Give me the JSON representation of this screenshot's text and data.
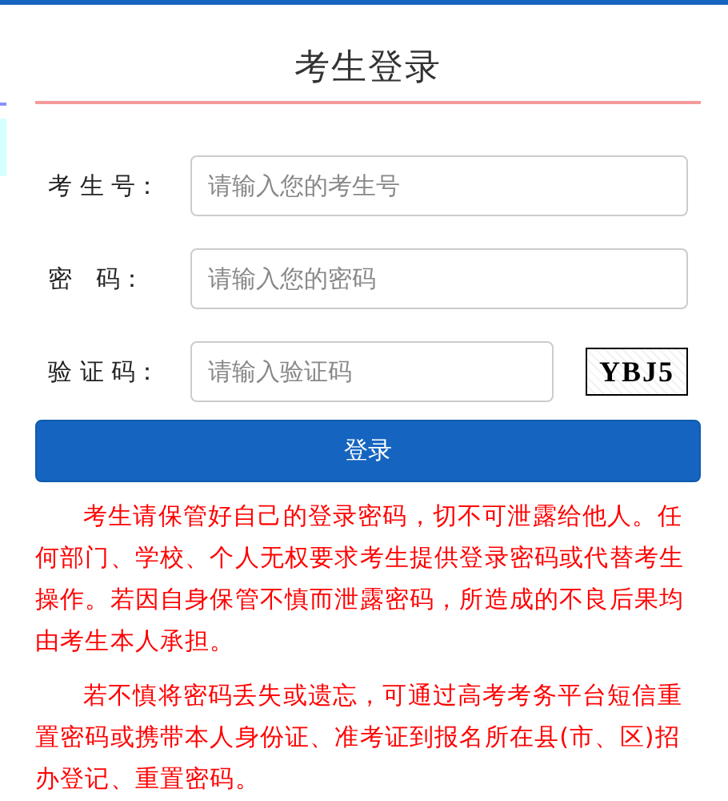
{
  "title": "考生登录",
  "fields": [
    {
      "label": "考 生 号：",
      "placeholder": "请输入您的考生号",
      "kind": "text"
    },
    {
      "label": "密　码：",
      "placeholder": "请输入您的密码",
      "kind": "password"
    },
    {
      "label": "验 证 码：",
      "placeholder": "请输入验证码",
      "kind": "captcha",
      "captcha": "YBJ5"
    }
  ],
  "login_button": "登录",
  "notices": [
    "考生请保管好自己的登录密码，切不可泄露给他人。任何部门、学校、个人无权要求考生提供登录密码或代替考生操作。若因自身保管不慎而泄露密码，所造成的不良后果均由考生本人承担。",
    "若不慎将密码丢失或遗忘，可通过高考考务平台短信重置密码或携带本人身份证、准考证到报名所在县(市、区)招办登记、重置密码。"
  ]
}
